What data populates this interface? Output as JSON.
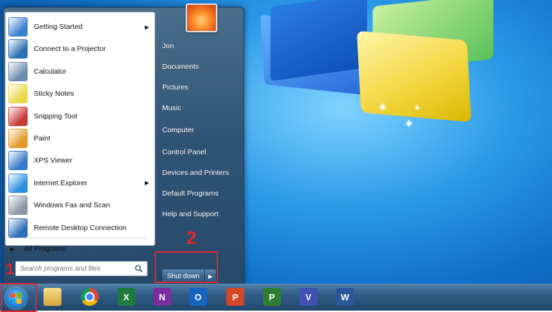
{
  "start_menu": {
    "programs": [
      {
        "label": "Getting Started",
        "icon": "getting-started-icon",
        "color": "#3b7fd1",
        "has_submenu": true
      },
      {
        "label": "Connect to a Projector",
        "icon": "projector-icon",
        "color": "#2c6fb3",
        "has_submenu": false
      },
      {
        "label": "Calculator",
        "icon": "calculator-icon",
        "color": "#6b8cad",
        "has_submenu": false
      },
      {
        "label": "Sticky Notes",
        "icon": "sticky-notes-icon",
        "color": "#e8d94a",
        "has_submenu": false
      },
      {
        "label": "Snipping Tool",
        "icon": "snipping-tool-icon",
        "color": "#c83b3b",
        "has_submenu": false
      },
      {
        "label": "Paint",
        "icon": "paint-icon",
        "color": "#e49a2a",
        "has_submenu": false
      },
      {
        "label": "XPS Viewer",
        "icon": "xps-viewer-icon",
        "color": "#3a78c9",
        "has_submenu": false
      },
      {
        "label": "Internet Explorer",
        "icon": "internet-explorer-icon",
        "color": "#2e8ee0",
        "has_submenu": true
      },
      {
        "label": "Windows Fax and Scan",
        "icon": "fax-scan-icon",
        "color": "#8a97a6",
        "has_submenu": false
      },
      {
        "label": "Remote Desktop Connection",
        "icon": "remote-desktop-icon",
        "color": "#2f6fb8",
        "has_submenu": false
      }
    ],
    "all_programs": "All Programs",
    "search_placeholder": "Search programs and files",
    "right_items": [
      "Jon",
      "Documents",
      "Pictures",
      "Music",
      "Computer",
      "Control Panel",
      "Devices and Printers",
      "Default Programs",
      "Help and Support"
    ],
    "shutdown_label": "Shut down"
  },
  "annotations": {
    "step_1": "1",
    "step_2": "2",
    "highlight_color": "#e3262a"
  },
  "taskbar": {
    "pinned": [
      {
        "icon": "file-explorer-icon",
        "glyph": "",
        "color": "#e8c05a"
      },
      {
        "icon": "chrome-icon",
        "glyph": "",
        "color": "#4285f4"
      },
      {
        "icon": "excel-icon",
        "glyph": "X",
        "color": "#1f7a3f"
      },
      {
        "icon": "onenote-icon",
        "glyph": "N",
        "color": "#7b2f9e"
      },
      {
        "icon": "outlook-icon",
        "glyph": "O",
        "color": "#1565c0"
      },
      {
        "icon": "powerpoint-icon",
        "glyph": "P",
        "color": "#d24726"
      },
      {
        "icon": "project-icon",
        "glyph": "P",
        "color": "#2e7d32"
      },
      {
        "icon": "visio-icon",
        "glyph": "V",
        "color": "#3f51b5"
      },
      {
        "icon": "word-icon",
        "glyph": "W",
        "color": "#2b579a"
      }
    ]
  }
}
